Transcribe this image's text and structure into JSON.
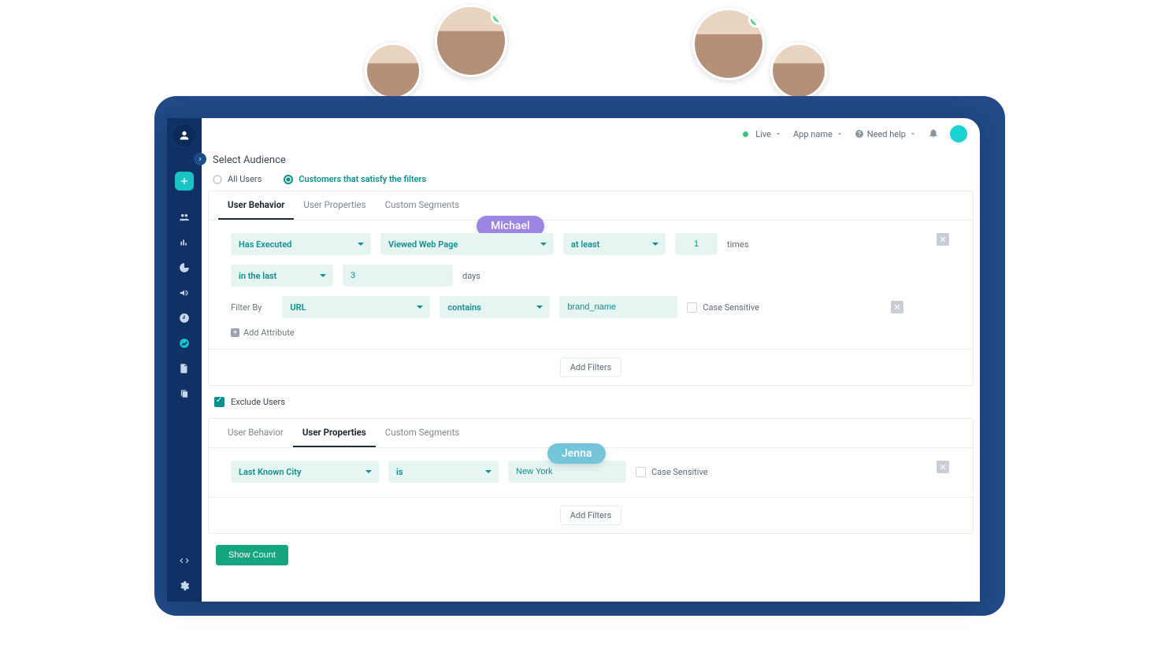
{
  "topbar": {
    "live": "Live",
    "app": "App name",
    "help": "Need help"
  },
  "section_title": "Select Audience",
  "audience_radio": {
    "all": "All Users",
    "filtered": "Customers that satisfy the filters"
  },
  "tabs": {
    "behavior": "User Behavior",
    "properties": "User Properties",
    "segments": "Custom Segments"
  },
  "behavior": {
    "has_executed": "Has Executed",
    "event": "Viewed Web Page",
    "quant": "at least",
    "count": "1",
    "times": "times",
    "range": "in the last",
    "range_val": "3",
    "days": "days",
    "filter_by": "Filter By",
    "attr": "URL",
    "op": "contains",
    "attr_val": "brand_name",
    "case_sensitive": "Case Sensitive",
    "add_attribute": "Add Attribute"
  },
  "add_filters": "Add Filters",
  "exclude_users": "Exclude Users",
  "properties_filter": {
    "prop": "Last Known City",
    "op": "is",
    "val": "New York",
    "case_sensitive": "Case Sensitive"
  },
  "show_count": "Show Count",
  "personas": {
    "michael": "Michael",
    "jenna": "Jenna"
  }
}
